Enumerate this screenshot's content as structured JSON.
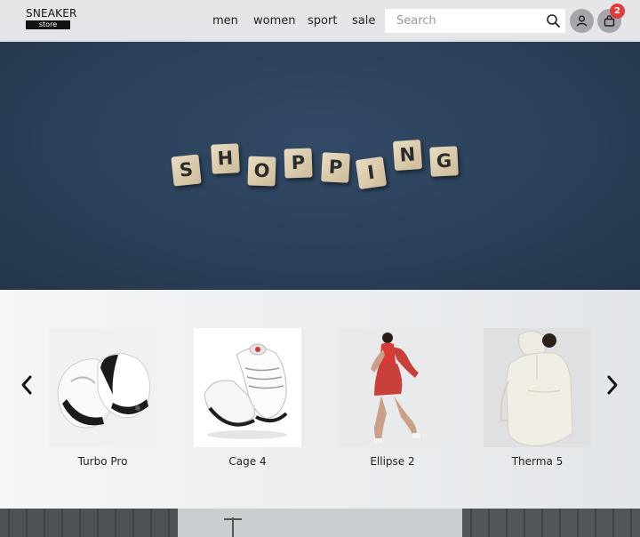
{
  "brand": {
    "top": "SNEAKER",
    "bottom": "store"
  },
  "nav": {
    "men": "men",
    "women": "women",
    "sport": "sport",
    "sale": "sale"
  },
  "search": {
    "placeholder": "Search",
    "value": ""
  },
  "icons": {
    "search": "search-icon",
    "user": "user-icon",
    "cart": "shopping-bag-icon",
    "prev": "chevron-left-icon",
    "next": "chevron-right-icon"
  },
  "cart": {
    "count": "2"
  },
  "hero": {
    "tiles": [
      "S",
      "H",
      "O",
      "P",
      "P",
      "I",
      "N",
      "G"
    ]
  },
  "products": [
    {
      "name": "Turbo Pro"
    },
    {
      "name": "Cage 4"
    },
    {
      "name": "Ellipse 2"
    },
    {
      "name": "Therma 5"
    }
  ],
  "colors": {
    "header_bg": "#e6e6e8",
    "hero_bg": "#2d425c",
    "badge": "#e23b3b",
    "icon_circle": "#a5a5ab"
  }
}
